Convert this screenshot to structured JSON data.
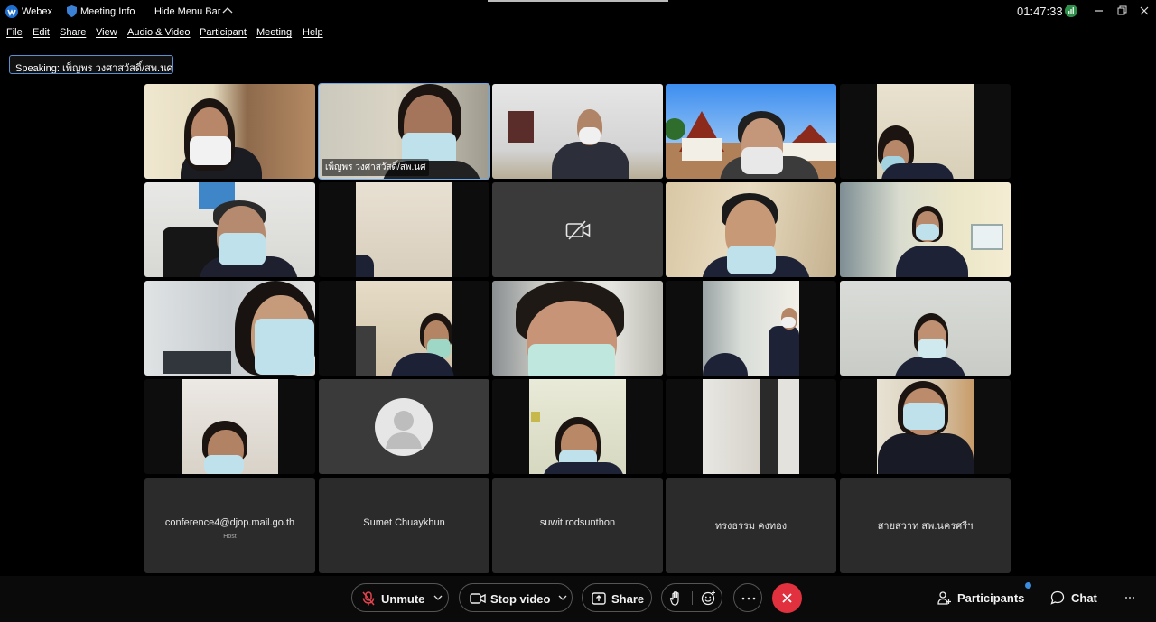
{
  "titlebar": {
    "app_name": "Webex",
    "meeting_info": "Meeting Info",
    "hide_menu_bar": "Hide Menu Bar",
    "clock": "01:47:33"
  },
  "menubar": {
    "items": [
      "File",
      "Edit",
      "Share",
      "View",
      "Audio & Video",
      "Participant",
      "Meeting",
      "Help"
    ]
  },
  "speaking": {
    "label": "Speaking: เพ็ญพร วงศาสวัสดิ์/สพ.นศ"
  },
  "grid": {
    "active_name": "เพ็ญพร วงศาสวัสดิ์/สพ.นศ",
    "name_tiles": [
      {
        "name": "conference4@djop.mail.go.th",
        "role": "Host"
      },
      {
        "name": "Sumet Chuaykhun",
        "role": ""
      },
      {
        "name": "suwit rodsunthon",
        "role": ""
      },
      {
        "name": "ทรงธรรม คงทอง",
        "role": ""
      },
      {
        "name": "สายสวาท สพ.นครศรีฯ",
        "role": ""
      }
    ]
  },
  "controls": {
    "unmute": "Unmute",
    "stop_video": "Stop video",
    "share": "Share",
    "participants": "Participants",
    "chat": "Chat",
    "end_call_color": "#e2313e",
    "accent_color": "#3a8dde"
  }
}
